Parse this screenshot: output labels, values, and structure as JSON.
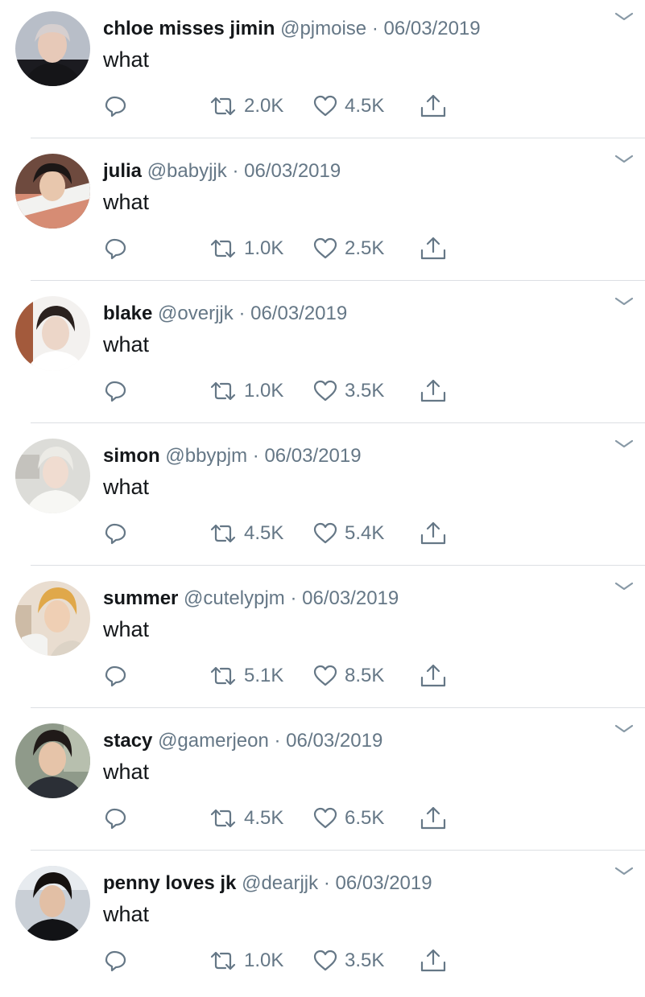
{
  "colors": {
    "text_primary": "#14171a",
    "text_secondary": "#657786",
    "icon": "#657786",
    "divider": "#dcdfe3"
  },
  "icons": {
    "reply": "reply-icon",
    "retweet": "retweet-icon",
    "like": "heart-icon",
    "share": "share-icon",
    "menu": "chevron-down-icon"
  },
  "tweets": [
    {
      "name": "chloe misses jimin",
      "handle": "@pjmoise",
      "sep": "·",
      "date": "06/03/2019",
      "text": "what",
      "retweets": "2.0K",
      "likes": "4.5K"
    },
    {
      "name": "julia",
      "handle": "@babyjjk",
      "sep": "·",
      "date": "06/03/2019",
      "text": "what",
      "retweets": "1.0K",
      "likes": "2.5K"
    },
    {
      "name": "blake",
      "handle": "@overjjk",
      "sep": "·",
      "date": "06/03/2019",
      "text": "what",
      "retweets": "1.0K",
      "likes": "3.5K"
    },
    {
      "name": "simon",
      "handle": "@bbypjm",
      "sep": "·",
      "date": "06/03/2019",
      "text": "what",
      "retweets": "4.5K",
      "likes": "5.4K"
    },
    {
      "name": "summer",
      "handle": "@cutelypjm",
      "sep": "·",
      "date": "06/03/2019",
      "text": "what",
      "retweets": "5.1K",
      "likes": "8.5K"
    },
    {
      "name": "stacy",
      "handle": "@gamerjeon",
      "sep": "·",
      "date": "06/03/2019",
      "text": "what",
      "retweets": "4.5K",
      "likes": "6.5K"
    },
    {
      "name": "penny loves jk",
      "handle": "@dearjjk",
      "sep": "·",
      "date": "06/03/2019",
      "text": "what",
      "retweets": "1.0K",
      "likes": "3.5K"
    }
  ]
}
